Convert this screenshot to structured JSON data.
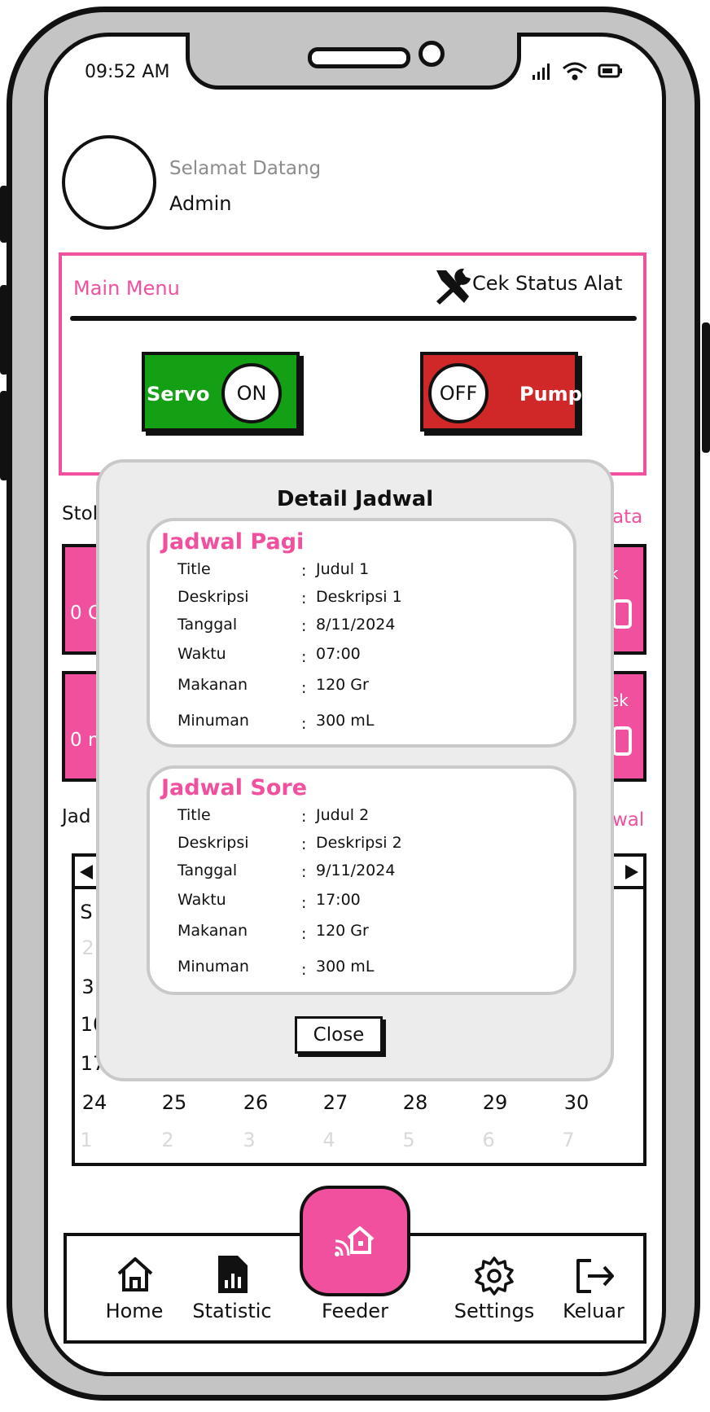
{
  "status_bar": {
    "time": "09:52 AM"
  },
  "header": {
    "greeting": "Selamat Datang",
    "username": "Admin"
  },
  "main_menu": {
    "title": "Main Menu",
    "status_button": "Cek Status Alat",
    "servo": {
      "label": "Servo",
      "state": "ON",
      "color": "#14a014"
    },
    "pump": {
      "label": "Pump",
      "state": "OFF",
      "color": "#d02828"
    }
  },
  "background": {
    "stok_label": "Stok",
    "lihat_data": "ata",
    "card1_value": "0 G",
    "card2_value": "0 m",
    "card1_side": "k",
    "card2_side": "ek",
    "jadwal_label": "Jad",
    "tambah_jadwal": "wal",
    "cal_day": "S",
    "cal_rows_partial": [
      "2",
      "3",
      "10",
      "17"
    ],
    "cal_last_row": [
      "24",
      "25",
      "26",
      "27",
      "28",
      "29",
      "30"
    ],
    "cal_next_row": [
      "1",
      "2",
      "3",
      "4",
      "5",
      "6",
      "7"
    ]
  },
  "modal": {
    "title": "Detail Jadwal",
    "close_label": "Close",
    "labels": [
      "Title",
      "Deskripsi",
      "Tanggal",
      "Waktu",
      "Makanan",
      "Minuman"
    ],
    "schedules": [
      {
        "heading": "Jadwal Pagi",
        "values": [
          "Judul 1",
          "Deskripsi 1",
          "8/11/2024",
          "07:00",
          "120 Gr",
          "300 mL"
        ]
      },
      {
        "heading": "Jadwal Sore",
        "values": [
          "Judul 2",
          "Deskripsi 2",
          "9/11/2024",
          "17:00",
          "120 Gr",
          "300 mL"
        ]
      }
    ]
  },
  "nav": {
    "home": "Home",
    "statistic": "Statistic",
    "feeder": "Feeder",
    "settings": "Settings",
    "keluar": "Keluar"
  },
  "colors": {
    "accent": "#f0509e",
    "servo_on": "#14a014",
    "pump_off": "#d02828"
  }
}
